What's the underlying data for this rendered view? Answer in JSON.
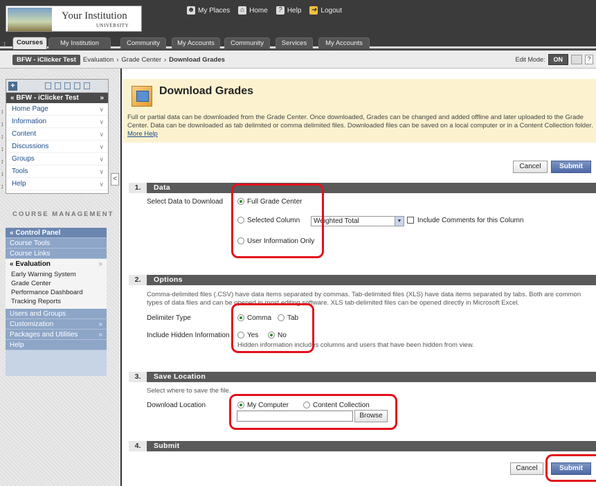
{
  "institution": {
    "name": "Your Institution",
    "sub": "UNIVERSITY"
  },
  "toplinks": [
    "My Places",
    "Home",
    "Help",
    "Logout"
  ],
  "tabs": [
    "Courses",
    "My Institution",
    "Community",
    "My Accounts",
    "Community",
    "Services",
    "My Accounts"
  ],
  "breadcrumb": {
    "course": "BFW - iClicker Test",
    "items": [
      "Evaluation",
      "Grade Center",
      "Download Grades"
    ],
    "sep": "›"
  },
  "edit_mode": {
    "label": "Edit Mode:",
    "value": "ON",
    "help": "?"
  },
  "course_menu": {
    "title": "BFW - iClicker Test",
    "items": [
      "Home Page",
      "Information",
      "Content",
      "Discussions",
      "Groups",
      "Tools",
      "Help"
    ]
  },
  "course_management": {
    "title": "COURSE MANAGEMENT",
    "control_panel": "Control Panel",
    "course_tools": "Course Tools",
    "course_links": "Course Links",
    "evaluation": "Evaluation",
    "evaluation_items": [
      "Early Warning System",
      "Grade Center",
      "Performance Dashboard",
      "Tracking Reports"
    ],
    "after": [
      "Users and Groups",
      "Customization",
      "Packages and Utilities",
      "Help"
    ]
  },
  "page": {
    "title": "Download Grades",
    "description": "Full or partial data can be downloaded from the Grade Center. Once downloaded, Grades can be changed and added offline and later uploaded to the Grade Center. Data can be downloaded as tab delimited or comma delimited files. Downloaded files can be saved on a local computer or in a Content Collection folder.",
    "more_help": "More Help"
  },
  "buttons": {
    "cancel": "Cancel",
    "submit": "Submit",
    "browse": "Browse"
  },
  "sections": {
    "data": {
      "num": "1.",
      "title": "Data",
      "label": "Select Data to Download",
      "opt_full": "Full Grade Center",
      "opt_column": "Selected Column",
      "column_value": "Weighted Total",
      "include_comments": "Include Comments for this Column",
      "opt_user": "User Information Only"
    },
    "options": {
      "num": "2.",
      "title": "Options",
      "help": "Comma-delimited files (.CSV) have data items separated by commas. Tab-delimited files (XLS) have data items separated by tabs. Both are common types of data files and can be opened in most editing software. XLS tab-delimited files can be opened directly in Microsoft Excel.",
      "delimiter_label": "Delimiter Type",
      "comma": "Comma",
      "tab": "Tab",
      "hidden_label": "Include Hidden Information",
      "yes": "Yes",
      "no": "No",
      "hidden_help": "Hidden information includes columns and users that have been hidden from view."
    },
    "save": {
      "num": "3.",
      "title": "Save Location",
      "help": "Select where to save the file.",
      "label": "Download Location",
      "my_computer": "My Computer",
      "content_collection": "Content Collection"
    },
    "submit": {
      "num": "4.",
      "title": "Submit"
    }
  },
  "colors": {
    "highlight": "#e3101c",
    "section_bar": "#5a5a5a",
    "info_bg": "#fdf2cf",
    "submit": "#4d69a5"
  }
}
